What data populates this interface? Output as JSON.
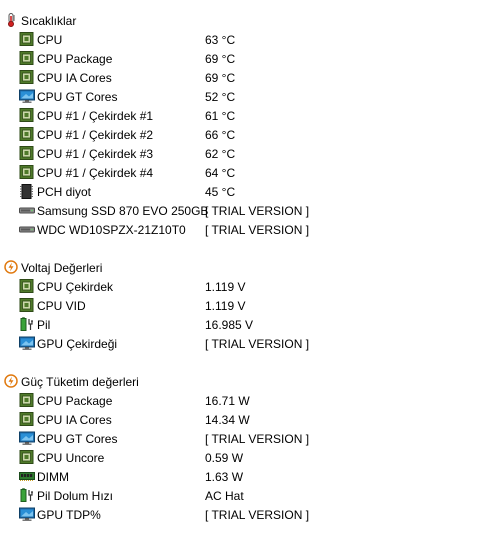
{
  "sections": [
    {
      "title": "Sıcaklıklar",
      "icon": "thermometer-icon",
      "items": [
        {
          "label": "CPU",
          "value": "63 °C",
          "icon": "cpu-chip-icon"
        },
        {
          "label": "CPU Package",
          "value": "69 °C",
          "icon": "cpu-chip-icon"
        },
        {
          "label": "CPU IA Cores",
          "value": "69 °C",
          "icon": "cpu-chip-icon"
        },
        {
          "label": "CPU GT Cores",
          "value": "52 °C",
          "icon": "monitor-icon"
        },
        {
          "label": "CPU #1 / Çekirdek #1",
          "value": "61 °C",
          "icon": "cpu-chip-icon"
        },
        {
          "label": "CPU #1 / Çekirdek #2",
          "value": "66 °C",
          "icon": "cpu-chip-icon"
        },
        {
          "label": "CPU #1 / Çekirdek #3",
          "value": "62 °C",
          "icon": "cpu-chip-icon"
        },
        {
          "label": "CPU #1 / Çekirdek #4",
          "value": "64 °C",
          "icon": "cpu-chip-icon"
        },
        {
          "label": "PCH diyot",
          "value": "45 °C",
          "icon": "chipset-icon"
        },
        {
          "label": "Samsung SSD 870 EVO 250GB",
          "value": "[ TRIAL VERSION ]",
          "icon": "drive-icon"
        },
        {
          "label": "WDC WD10SPZX-21Z10T0",
          "value": "[ TRIAL VERSION ]",
          "icon": "drive-icon"
        }
      ]
    },
    {
      "title": "Voltaj Değerleri",
      "icon": "voltage-icon",
      "items": [
        {
          "label": "CPU Çekirdek",
          "value": "1.119 V",
          "icon": "cpu-chip-icon"
        },
        {
          "label": "CPU VID",
          "value": "1.119 V",
          "icon": "cpu-chip-icon"
        },
        {
          "label": "Pil",
          "value": "16.985 V",
          "icon": "battery-icon"
        },
        {
          "label": "GPU Çekirdeği",
          "value": "[ TRIAL VERSION ]",
          "icon": "monitor-icon"
        }
      ]
    },
    {
      "title": "Güç Tüketim değerleri",
      "icon": "power-icon",
      "items": [
        {
          "label": "CPU Package",
          "value": "16.71 W",
          "icon": "cpu-chip-icon"
        },
        {
          "label": "CPU IA Cores",
          "value": "14.34 W",
          "icon": "cpu-chip-icon"
        },
        {
          "label": "CPU GT Cores",
          "value": "[ TRIAL VERSION ]",
          "icon": "monitor-icon"
        },
        {
          "label": "CPU Uncore",
          "value": "0.59 W",
          "icon": "cpu-chip-icon"
        },
        {
          "label": "DIMM",
          "value": "1.63 W",
          "icon": "memory-icon"
        },
        {
          "label": "Pil Dolum Hızı",
          "value": "AC Hat",
          "icon": "battery-icon"
        },
        {
          "label": "GPU TDP%",
          "value": "[ TRIAL VERSION ]",
          "icon": "monitor-icon"
        }
      ]
    }
  ],
  "colors": {
    "chip_green": "#4f7a2a",
    "chip_border": "#2e4a17",
    "monitor_blue": "#2a8fd6",
    "voltage_orange": "#e07a10",
    "battery_green": "#3aa33a",
    "thermo_red": "#d02020"
  }
}
